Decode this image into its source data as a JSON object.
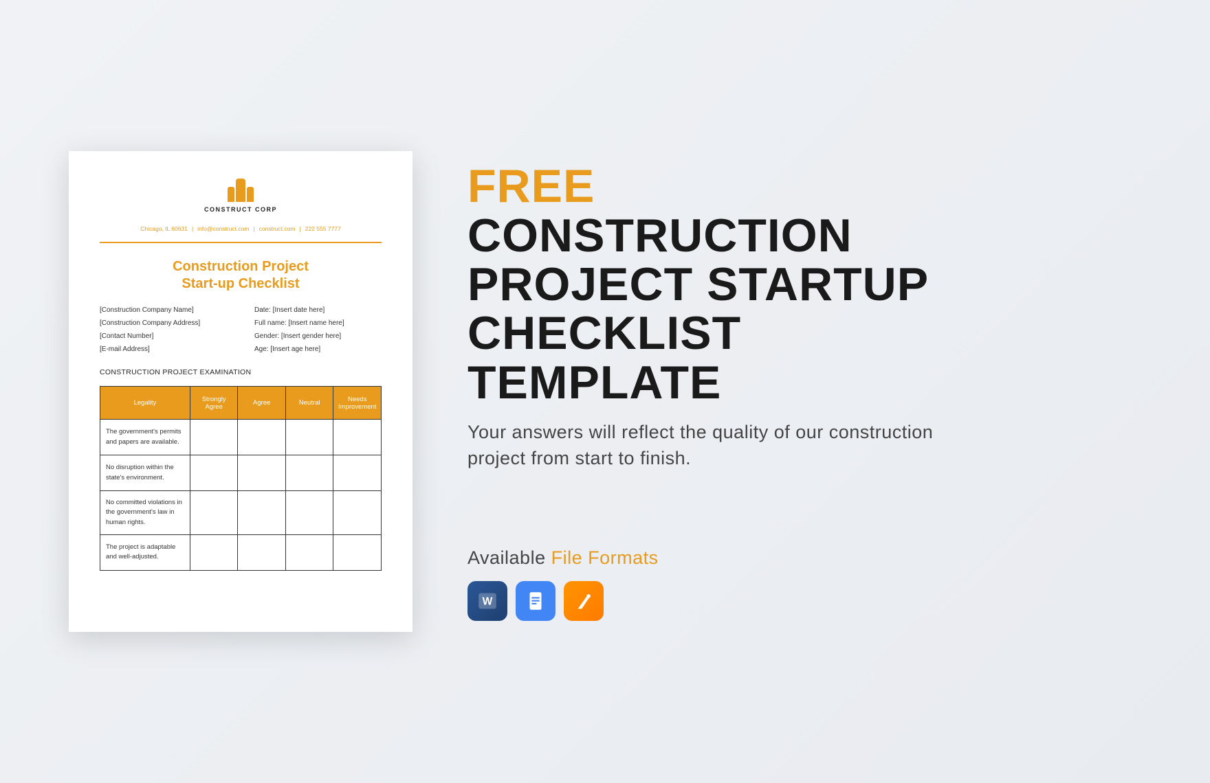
{
  "document": {
    "logo_name": "CONSTRUCT CORP",
    "contact": {
      "city": "Chicago, IL 60631",
      "email": "info@construct.com",
      "website": "construct.com",
      "phone": "222 555 7777"
    },
    "title_line1": "Construction Project",
    "title_line2": "Start-up Checklist",
    "left_fields": [
      "[Construction Company Name]",
      "[Construction Company Address]",
      "[Contact Number]",
      "[E-mail Address]"
    ],
    "right_fields": [
      "Date: [Insert date here]",
      "Full name: [Insert name here]",
      "Gender: [Insert gender here]",
      "Age: [Insert age here]"
    ],
    "section": "CONSTRUCTION PROJECT EXAMINATION",
    "table": {
      "headers": [
        "Legality",
        "Strongly Agree",
        "Agree",
        "Neutral",
        "Needs Improvement"
      ],
      "rows": [
        "The government's permits and papers are available.",
        "No disruption within the state's environment.",
        "No committed violations in the government's law in human rights.",
        "The project is adaptable and well-adjusted."
      ]
    }
  },
  "promo": {
    "tag": "FREE",
    "title": "CONSTRUCTION PROJECT STARTUP CHECKLIST TEMPLATE",
    "description": "Your answers will reflect the quality of our construction project from start to finish.",
    "formats_prefix": "Available",
    "formats_highlight": "File Formats"
  }
}
